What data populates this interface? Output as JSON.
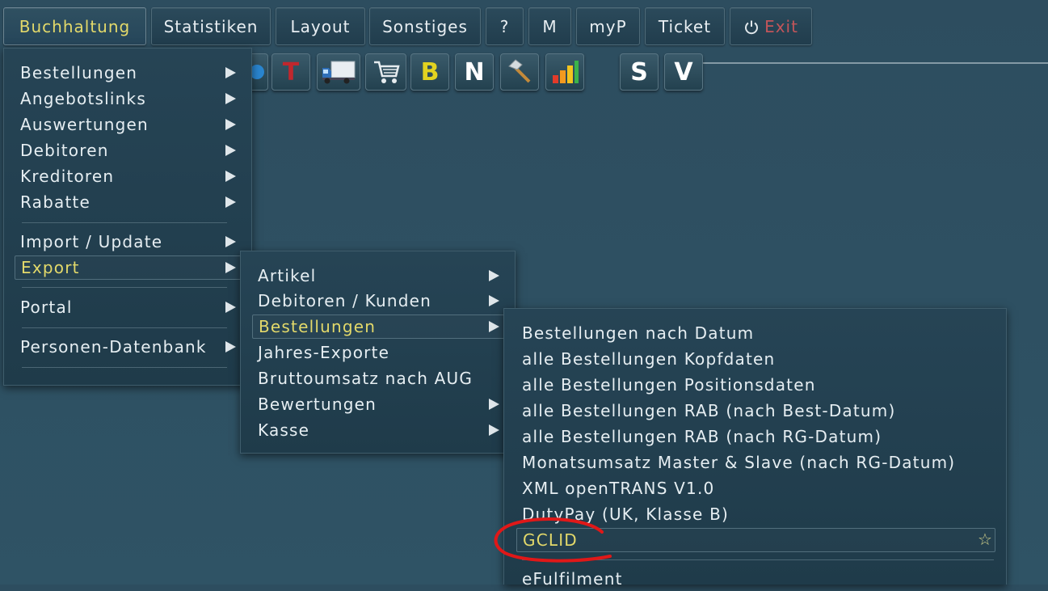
{
  "menubar": {
    "items": [
      "Buchhaltung",
      "Statistiken",
      "Layout",
      "Sonstiges",
      "?",
      "M",
      "myP",
      "Ticket"
    ],
    "exit_label": "Exit"
  },
  "toolbar": {
    "icons": [
      {
        "name": "t-icon",
        "glyph": "T",
        "color": "#c0272d"
      },
      {
        "name": "truck-icon"
      },
      {
        "name": "cart-icon"
      },
      {
        "name": "b-icon",
        "glyph": "B",
        "color": "#e2d220"
      },
      {
        "name": "n-icon",
        "glyph": "N",
        "color": "#ffffff"
      },
      {
        "name": "hammer-icon"
      },
      {
        "name": "bar-chart-icon"
      },
      {
        "name": "s-icon",
        "glyph": "S",
        "color": "#ffffff"
      },
      {
        "name": "v-icon",
        "glyph": "V",
        "color": "#ffffff"
      }
    ]
  },
  "menu1": {
    "items": [
      "Bestellungen",
      "Angebotslinks",
      "Auswertungen",
      "Debitoren",
      "Kreditoren",
      "Rabatte",
      "Import / Update",
      "Export",
      "Portal",
      "Personen-Datenbank"
    ]
  },
  "menu2": {
    "items": [
      "Artikel",
      "Debitoren / Kunden",
      "Bestellungen",
      "Jahres-Exporte",
      "Bruttoumsatz nach AUG",
      "Bewertungen",
      "Kasse"
    ]
  },
  "menu3": {
    "items": [
      "Bestellungen nach Datum",
      "alle Bestellungen Kopfdaten",
      "alle Bestellungen Positionsdaten",
      "alle Bestellungen RAB (nach Best-Datum)",
      "alle Bestellungen RAB (nach RG-Datum)",
      "Monatsumsatz Master & Slave (nach RG-Datum)",
      "XML openTRANS V1.0",
      "DutyPay (UK, Klasse B)",
      "GCLID",
      "eFulfilment"
    ]
  },
  "colors": {
    "highlight_text": "#e3d96a",
    "annotation_circle": "#e01818",
    "exit_text": "#c2555a"
  }
}
